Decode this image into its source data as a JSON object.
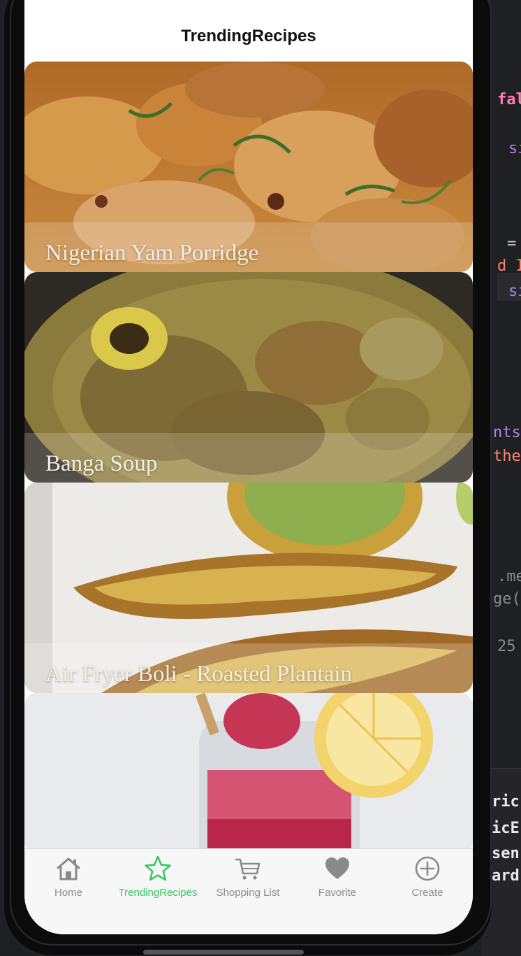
{
  "app": {
    "title": "TrendingRecipes"
  },
  "recipes": [
    {
      "name": "Nigerian Yam Porridge"
    },
    {
      "name": "Banga Soup"
    },
    {
      "name": "Air Fryer Boli - Roasted Plantain"
    },
    {
      "name": ""
    }
  ],
  "tabs": [
    {
      "label": "Home",
      "icon": "house-icon",
      "active": false
    },
    {
      "label": "TrendingRecipes",
      "icon": "star-icon",
      "active": true
    },
    {
      "label": "Shopping List",
      "icon": "cart-icon",
      "active": false
    },
    {
      "label": "Favorite",
      "icon": "heart-icon",
      "active": false
    },
    {
      "label": "Create",
      "icon": "plus-circle-icon",
      "active": false
    }
  ],
  "editor_fragments": [
    "fal",
    "si",
    "=",
    "d I",
    "si",
    "nts",
    "the",
    ".me",
    "ge(s",
    "25",
    "ric",
    "icE",
    "sen",
    "ard"
  ],
  "colors": {
    "accent": "#34c759",
    "inactive": "#8a8a8a"
  }
}
